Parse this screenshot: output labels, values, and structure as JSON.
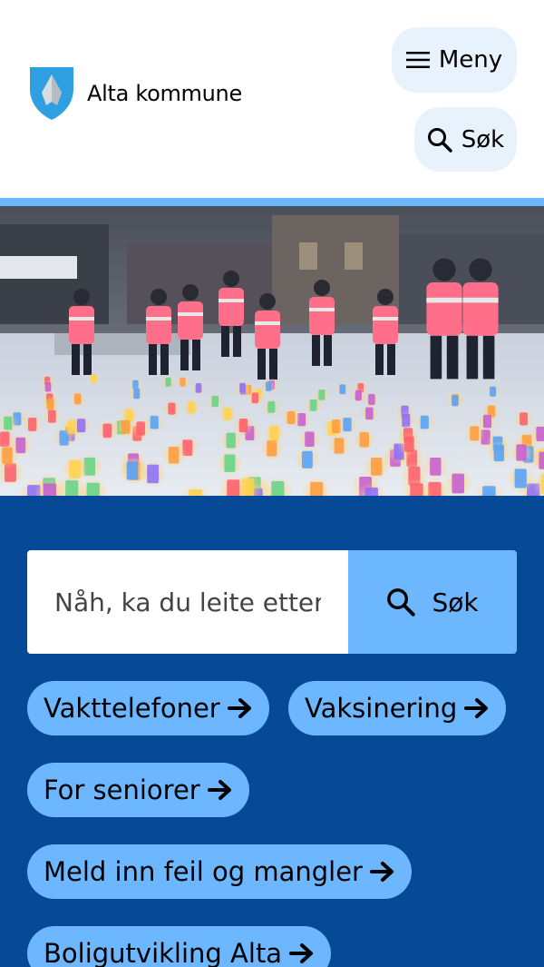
{
  "header": {
    "logo_text": "Alta kommune",
    "menu_label": "Meny",
    "search_label": "Søk"
  },
  "search": {
    "placeholder": "Nåh, ka du leite etter?",
    "button_label": "Søk"
  },
  "quick_links": [
    {
      "label": "Vakttelefoner",
      "icon": "arrow-right-icon"
    },
    {
      "label": "Vaksinering",
      "icon": "arrow-right-icon"
    },
    {
      "label": "For seniorer",
      "icon": "arrow-right-icon"
    },
    {
      "label": "Meld inn feil og mangler",
      "icon": "arrow-right-icon"
    },
    {
      "label": "Boligutvikling Alta",
      "icon": "arrow-right-icon"
    }
  ],
  "colors": {
    "accent": "#6cb7ff",
    "brand_dark": "#064a97",
    "pill_bg": "#e8f2fd"
  }
}
